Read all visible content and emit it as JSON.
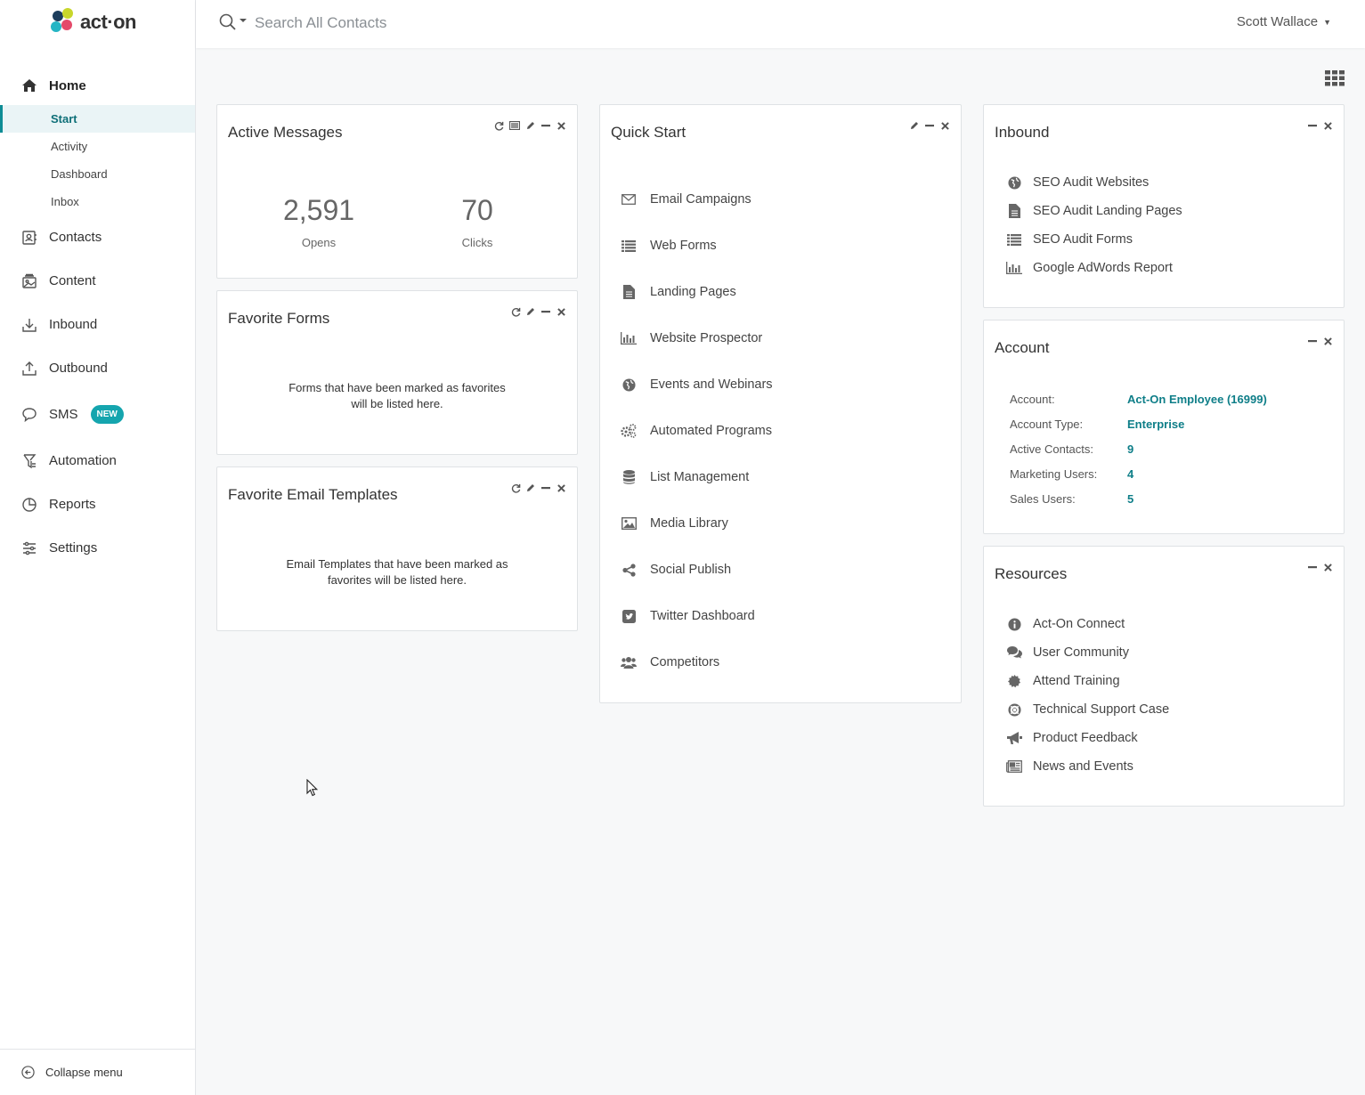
{
  "brand": {
    "name": "act·on"
  },
  "search": {
    "placeholder": "Search All Contacts"
  },
  "user": {
    "name": "Scott Wallace"
  },
  "sidebar": {
    "home": "Home",
    "sub": [
      "Start",
      "Activity",
      "Dashboard",
      "Inbox"
    ],
    "items": [
      {
        "label": "Contacts",
        "icon": "contacts-icon"
      },
      {
        "label": "Content",
        "icon": "content-icon"
      },
      {
        "label": "Inbound",
        "icon": "inbound-icon"
      },
      {
        "label": "Outbound",
        "icon": "outbound-icon"
      },
      {
        "label": "SMS",
        "icon": "sms-icon",
        "badge": "NEW"
      },
      {
        "label": "Automation",
        "icon": "automation-icon"
      },
      {
        "label": "Reports",
        "icon": "reports-icon"
      },
      {
        "label": "Settings",
        "icon": "settings-icon"
      }
    ],
    "collapse": "Collapse menu"
  },
  "active_messages": {
    "title": "Active Messages",
    "opens_value": "2,591",
    "opens_label": "Opens",
    "clicks_value": "70",
    "clicks_label": "Clicks"
  },
  "favorite_forms": {
    "title": "Favorite Forms",
    "empty": "Forms that have been marked as favorites will be listed here."
  },
  "favorite_templates": {
    "title": "Favorite Email Templates",
    "empty": "Email Templates that have been marked as favorites will be listed here."
  },
  "quick_start": {
    "title": "Quick Start",
    "items": [
      "Email Campaigns",
      "Web Forms",
      "Landing Pages",
      "Website Prospector",
      "Events and Webinars",
      "Automated Programs",
      "List Management",
      "Media Library",
      "Social Publish",
      "Twitter Dashboard",
      "Competitors"
    ]
  },
  "inbound": {
    "title": "Inbound",
    "items": [
      "SEO Audit Websites",
      "SEO Audit Landing Pages",
      "SEO Audit Forms",
      "Google AdWords Report"
    ]
  },
  "account": {
    "title": "Account",
    "rows": [
      {
        "k": "Account:",
        "v": "Act-On Employee (16999)"
      },
      {
        "k": "Account Type:",
        "v": "Enterprise"
      },
      {
        "k": "Active Contacts:",
        "v": "9"
      },
      {
        "k": "Marketing Users:",
        "v": "4"
      },
      {
        "k": "Sales Users:",
        "v": "5"
      }
    ]
  },
  "resources": {
    "title": "Resources",
    "items": [
      "Act-On Connect",
      "User Community",
      "Attend Training",
      "Technical Support Case",
      "Product Feedback",
      "News and Events"
    ]
  },
  "colors": {
    "accent": "#0e8c95",
    "badge": "#15a5ae",
    "link": "#0e7e88"
  }
}
